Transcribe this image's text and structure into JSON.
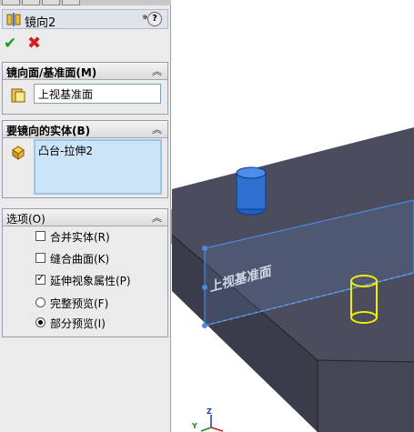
{
  "property_manager": {
    "title": "镜向2",
    "help_icon": "pushpin-help-icon",
    "ok_icon": "check-icon",
    "cancel_icon": "x-icon"
  },
  "groups": {
    "mirror_face": {
      "title": "镜向面/基准面(M)",
      "value": "上视基准面"
    },
    "bodies": {
      "title": "要镜向的实体(B)",
      "items": [
        "凸台-拉伸2"
      ]
    },
    "options": {
      "title": "选项(O)",
      "merge_solids": {
        "label": "合并实体(R)",
        "checked": false
      },
      "knit_surfaces": {
        "label": "缝合曲面(K)",
        "checked": false
      },
      "propagate_visual": {
        "label": "延伸视象属性(P)",
        "checked": true
      },
      "full_preview": {
        "label": "完整预览(F)",
        "selected": false
      },
      "partial_preview": {
        "label": "部分预览(I)",
        "selected": true
      }
    }
  },
  "viewport": {
    "plane_label": "上视基准面",
    "triad_z": "Z",
    "triad_y": "Y"
  },
  "colors": {
    "body_face": "#4b4d5e",
    "body_side": "#3a3c4a",
    "selected_blue": "#1f5fbf",
    "preview_yellow": "#f0f000",
    "plane_blue": "#4a8ae0"
  }
}
